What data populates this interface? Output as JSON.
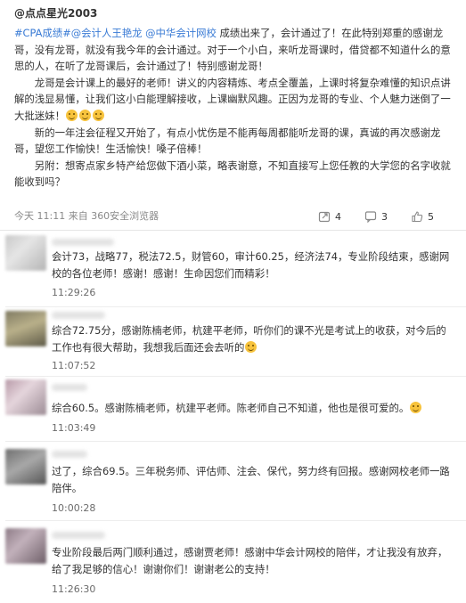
{
  "post": {
    "author": "@点点星光2003",
    "tag1": "#CPA成绩#",
    "mention1": "@会计人王艳龙",
    "mention2": "@中华会计网校",
    "para1_rest": " 成绩出来了，会计通过了！在此特别郑重的感谢龙哥，没有龙哥，就没有我今年的会计通过。对于一个小白，来听龙哥课时，借贷都不知道什么的意思的人，在听了龙哥课后，会计通过了！特别感谢龙哥！",
    "para2": "龙哥是会计课上的最好的老师！讲义的内容精炼、考点全覆盖，上课时将复杂难懂的知识点讲解的浅显易懂，让我们这小白能理解接收，上课幽默风趣。正因为龙哥的专业、个人魅力迷倒了一大批迷妹！",
    "para3": "新的一年注会征程又开始了，有点小忧伤是不能再每周都能听龙哥的课，真诚的再次感谢龙哥，望您工作愉快！生活愉快！嗓子倍棒！",
    "para4": "另附：想寄点家乡特产给您做下酒小菜，略表谢意，不知直接写上您任教的大学您的名字收就能收到吗？",
    "meta": "今天 11:11 来自 360安全浏览器",
    "repost_count": "4",
    "comment_count": "3",
    "like_count": "5"
  },
  "comments": [
    {
      "text": "会计73，战略77，税法72.5，财管60，审计60.25，经济法74，专业阶段结束，感谢网校的各位老师！感谢！感谢！生命因您们而精彩！",
      "time": "11:29:26"
    },
    {
      "text": "综合72.75分，感谢陈楠老师，杭建平老师，听你们的课不光是考试上的收获，对今后的工作也有很大帮助，我想我后面还会去听的",
      "time": "11:07:52"
    },
    {
      "text": "综合60.5。感谢陈楠老师，杭建平老师。陈老师自己不知道，他也是很可爱的。",
      "time": "11:03:49"
    },
    {
      "text": "过了，综合69.5。三年税务师、评估师、注会、保代，努力终有回报。感谢网校老师一路陪伴。",
      "time": "10:00:28"
    },
    {
      "text": "专业阶段最后两门顺利通过，感谢贾老师！感谢中华会计网校的陪伴，才让我没有放弃，给了我足够的信心！谢谢你们！谢谢老公的支持！",
      "time": "11:26:30"
    }
  ],
  "colors": {
    "link": "#3a7bd5",
    "meta_text": "#8a8a8a",
    "divider": "#e6e6e6"
  },
  "icons": {
    "repost": "repost-icon",
    "comment": "comment-icon",
    "like": "thumbs-up-icon",
    "emoji": "smile-emoji-icon"
  }
}
